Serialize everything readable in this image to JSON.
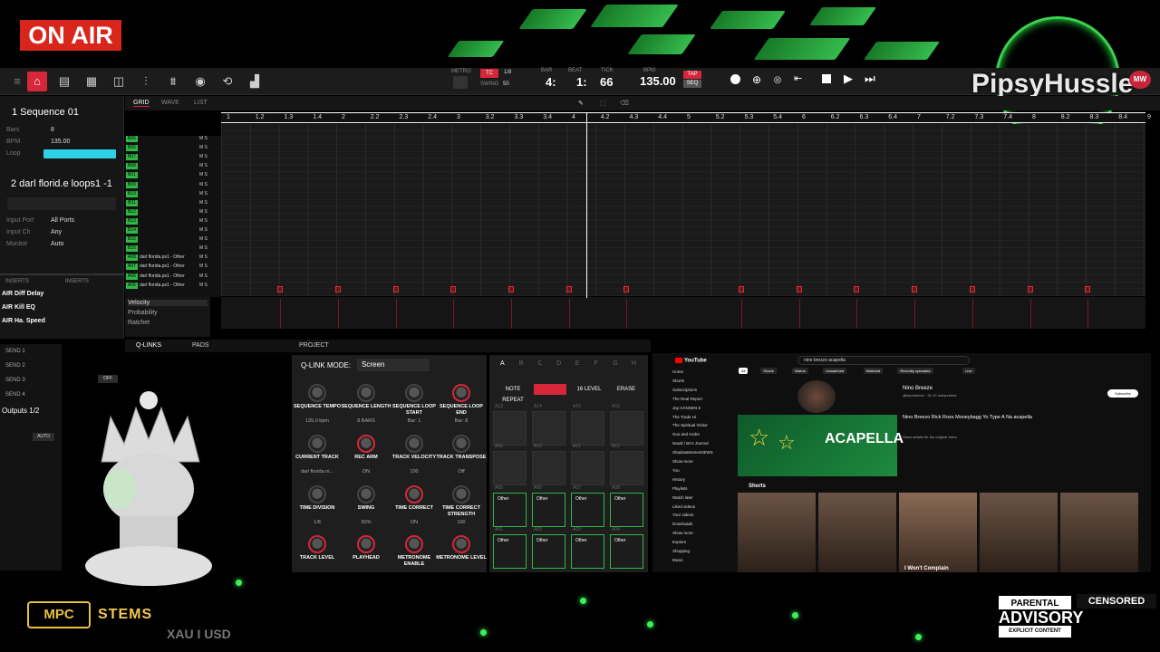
{
  "overlay": {
    "on_air": "ON AIR",
    "brand": "PipsyHussle",
    "mw_badge": "MW",
    "stems": "STEMS",
    "mpc_logo": "MPC",
    "xau": "XAU I USD",
    "advisory": [
      "PARENTAL",
      "ADVISORY",
      "EXPLICIT CONTENT"
    ],
    "censored": "CENSORED"
  },
  "toolbar": {
    "labels": {
      "metro": "METRO",
      "tc": "TC",
      "tc_val": "1/8",
      "swing": "SWING",
      "swing_val": "50",
      "bar": "BAR",
      "beat": "BEAT",
      "tick": "TICK",
      "bpm": "BPM",
      "tap": "TAP",
      "seq": "SEQ"
    },
    "bar": "4:",
    "beat": "1:",
    "tick": "66",
    "bpm": "135.00"
  },
  "left": {
    "sequence": "1 Sequence 01",
    "bars_label": "Bars",
    "bars": "8",
    "bpm_label": "BPM",
    "bpm": "135.00",
    "loop_label": "Loop",
    "track": "2 darl florid.e loops1 -1",
    "input_port_label": "Input Port",
    "input_port": "All Ports",
    "input_ch_label": "Input Ch",
    "input_ch": "Any",
    "monitor_label": "Monitor",
    "monitor": "Auto",
    "inserts": [
      "AIR Diff Delay",
      "AIR Kill EQ",
      "AIR Ha. Speed"
    ],
    "inserts_header": "INSERTS",
    "sends": [
      "SEND 1",
      "SEND 2",
      "SEND 3",
      "SEND 4"
    ],
    "outputs": "Outputs 1/2",
    "auto": "AUTO",
    "off": "OFF"
  },
  "grid": {
    "tabs": [
      "GRID",
      "WAVE",
      "LIST"
    ],
    "ruler": [
      "1",
      "1.2",
      "1.3",
      "1.4",
      "2",
      "2.2",
      "2.3",
      "2.4",
      "3",
      "3.2",
      "3.3",
      "3.4",
      "4",
      "4.2",
      "4.3",
      "4.4",
      "5",
      "5.2",
      "5.3",
      "5.4",
      "6",
      "6.2",
      "6.3",
      "6.4",
      "7",
      "7.2",
      "7.3",
      "7.4",
      "8",
      "8.2",
      "8.3",
      "8.4",
      "9"
    ],
    "tracks": [
      {
        "num": "B05",
        "name": ""
      },
      {
        "num": "B06",
        "name": ""
      },
      {
        "num": "B07",
        "name": ""
      },
      {
        "num": "B08",
        "name": ""
      },
      {
        "num": "B01",
        "name": ""
      },
      {
        "num": "B09",
        "name": ""
      },
      {
        "num": "B10",
        "name": ""
      },
      {
        "num": "B11",
        "name": ""
      },
      {
        "num": "B12",
        "name": ""
      },
      {
        "num": "B13",
        "name": ""
      },
      {
        "num": "B14",
        "name": ""
      },
      {
        "num": "B15",
        "name": ""
      },
      {
        "num": "B16",
        "name": ""
      },
      {
        "num": "A08",
        "name": "darl florida.ps1 - Other"
      },
      {
        "num": "A07",
        "name": "darl florida.ps1 - Other"
      },
      {
        "num": "A06",
        "name": "darl florida.ps1 - Other"
      },
      {
        "num": "A05",
        "name": "darl florida.ps1 - Other"
      }
    ],
    "vel_menu": [
      "Velocity",
      "Probability",
      "Ratchet"
    ]
  },
  "bottom": {
    "tabs": [
      "Q-LINKS",
      "PADS",
      "PROJECT"
    ],
    "qlink_mode_label": "Q-LINK MODE:",
    "qlink_mode": "Screen",
    "knobs": [
      {
        "label": "SEQUENCE TEMPO",
        "value": "135.0 bpm"
      },
      {
        "label": "SEQUENCE LENGTH",
        "value": "8 BARS"
      },
      {
        "label": "SEQUENCE LOOP START",
        "value": "Bar: 1"
      },
      {
        "label": "SEQUENCE LOOP END",
        "value": "Bar: 8"
      },
      {
        "label": "CURRENT TRACK",
        "value": "darl florida ni..."
      },
      {
        "label": "REC ARM",
        "value": "ON"
      },
      {
        "label": "TRACK VELOCITY",
        "value": "100"
      },
      {
        "label": "TRACK TRANSPOSE",
        "value": "Off"
      },
      {
        "label": "TIME DIVISION",
        "value": "1/8"
      },
      {
        "label": "SWING",
        "value": "50%"
      },
      {
        "label": "TIME CORRECT",
        "value": "ON"
      },
      {
        "label": "TIME CORRECT STRENGTH",
        "value": "100"
      },
      {
        "label": "TRACK LEVEL",
        "value": ""
      },
      {
        "label": "PLAYHEAD",
        "value": ""
      },
      {
        "label": "METRONOME ENABLE",
        "value": ""
      },
      {
        "label": "METRONOME LEVEL",
        "value": ""
      }
    ],
    "pad_banks": [
      "A",
      "B",
      "C",
      "D",
      "E",
      "F",
      "G",
      "H"
    ],
    "pad_buttons": [
      "NOTE REPEAT",
      "16 LEVEL",
      "ERASE"
    ],
    "pad_nums_top": [
      "A13",
      "A14",
      "A15",
      "A16",
      "A09",
      "A10",
      "A11",
      "A12",
      "A05",
      "A06",
      "A07",
      "A08",
      "A01",
      "A02",
      "A03",
      "A04"
    ],
    "pad_labels": [
      "Other",
      "Other",
      "Other",
      "Other",
      "Other",
      "Other",
      "Other",
      "Other"
    ]
  },
  "youtube": {
    "logo": "YouTube",
    "search": "nino brezzo acapella",
    "sidebar": [
      "Home",
      "Shorts",
      "Subscriptions",
      "The Real Report",
      "Jay HANSEN S",
      "The Trade Hi",
      "The Spiritual Visitor",
      "Gus and Andre",
      "Nasdi / Bs's Journal",
      "ShadowMomenNEWS",
      "Show more",
      "You",
      "History",
      "Playlists",
      "Watch later",
      "Liked videos",
      "Your videos",
      "Downloads",
      "Show more",
      "Explore",
      "Shopping",
      "Music"
    ],
    "chips": [
      "All",
      "Shorts",
      "Videos",
      "Unwatched",
      "Watched",
      "Recently uploaded",
      "Live"
    ],
    "channel": "Nino Breeze",
    "channel_sub": "@ninobreeze · 31.7K subscribers",
    "subscribe": "Subscribe",
    "video_title": "Nino Breezo Rick Ross Moneybagg Yo Type A Na acapella",
    "video_desc": "Show details for the original video",
    "acapella": "ACAPELLA",
    "shorts_label": "Shorts",
    "short_caption": "I Won't Complain"
  }
}
